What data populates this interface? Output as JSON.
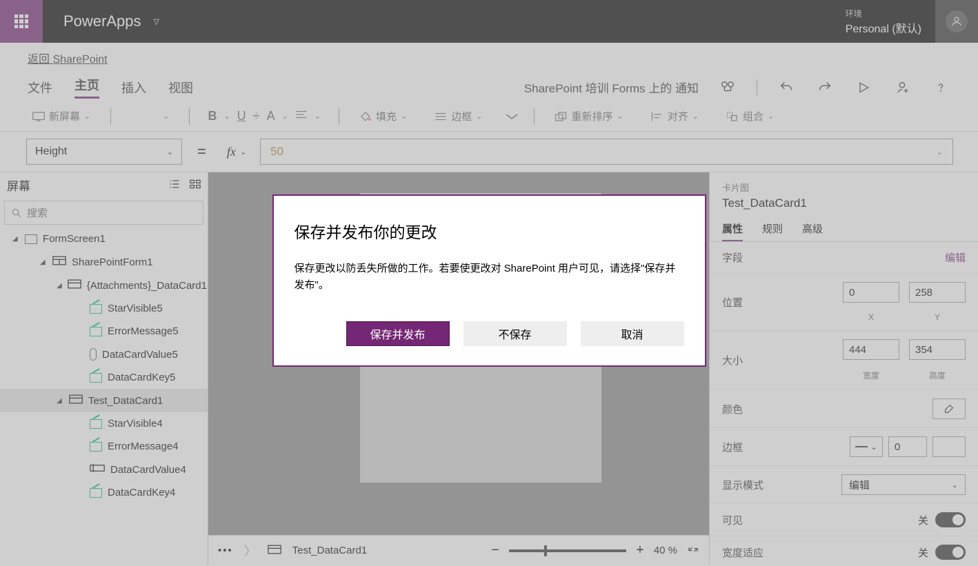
{
  "brand": "PowerApps",
  "environment": {
    "label": "环境",
    "value": "Personal (默认)"
  },
  "back_link": "返回 SharePoint",
  "menu": {
    "file": "文件",
    "home": "主页",
    "insert": "插入",
    "view": "视图"
  },
  "notice": "SharePoint 培训 Forms 上的 通知",
  "toolbar": {
    "new_screen": "新屏幕",
    "fill": "填充",
    "border": "边框",
    "reorder": "重新排序",
    "align": "对齐",
    "group": "组合"
  },
  "formula": {
    "property": "Height",
    "value": "50"
  },
  "tree": {
    "title": "屏幕",
    "search_placeholder": "搜索",
    "items": [
      {
        "label": "FormScreen1",
        "depth": 1,
        "icon": "screen",
        "caret": true
      },
      {
        "label": "SharePointForm1",
        "depth": 2,
        "icon": "form",
        "caret": true
      },
      {
        "label": "{Attachments}_DataCard1",
        "depth": 3,
        "icon": "card",
        "caret": true
      },
      {
        "label": "StarVisible5",
        "depth": 4,
        "icon": "ctl"
      },
      {
        "label": "ErrorMessage5",
        "depth": 4,
        "icon": "ctl"
      },
      {
        "label": "DataCardValue5",
        "depth": 4,
        "icon": "attach"
      },
      {
        "label": "DataCardKey5",
        "depth": 4,
        "icon": "ctl"
      },
      {
        "label": "Test_DataCard1",
        "depth": 3,
        "icon": "card",
        "caret": true,
        "selected": true
      },
      {
        "label": "StarVisible4",
        "depth": 4,
        "icon": "ctl"
      },
      {
        "label": "ErrorMessage4",
        "depth": 4,
        "icon": "ctl"
      },
      {
        "label": "DataCardValue4",
        "depth": 4,
        "icon": "input"
      },
      {
        "label": "DataCardKey4",
        "depth": 4,
        "icon": "ctl"
      }
    ]
  },
  "canvas": {
    "breadcrumb": "Test_DataCard1",
    "zoom": "40  %"
  },
  "side": {
    "section": "卡片图",
    "name": "Test_DataCard1",
    "tabs": {
      "props": "属性",
      "rules": "规则",
      "advanced": "高级"
    },
    "fields_label": "字段",
    "edit": "编辑",
    "position": "位置",
    "pos_x": "0",
    "pos_y": "258",
    "xl": "X",
    "yl": "Y",
    "size": "大小",
    "w": "444",
    "h": "354",
    "wl": "宽度",
    "hl": "高度",
    "color": "颜色",
    "border": "边框",
    "border_val": "0",
    "display_mode": "显示模式",
    "display_val": "编辑",
    "visible": "可见",
    "width_fit": "宽度适应",
    "off": "关"
  },
  "dialog": {
    "title": "保存并发布你的更改",
    "body": "保存更改以防丢失所做的工作。若要使更改对 SharePoint 用户可见，请选择\"保存并发布\"。",
    "primary": "保存并发布",
    "dont_save": "不保存",
    "cancel": "取消"
  }
}
